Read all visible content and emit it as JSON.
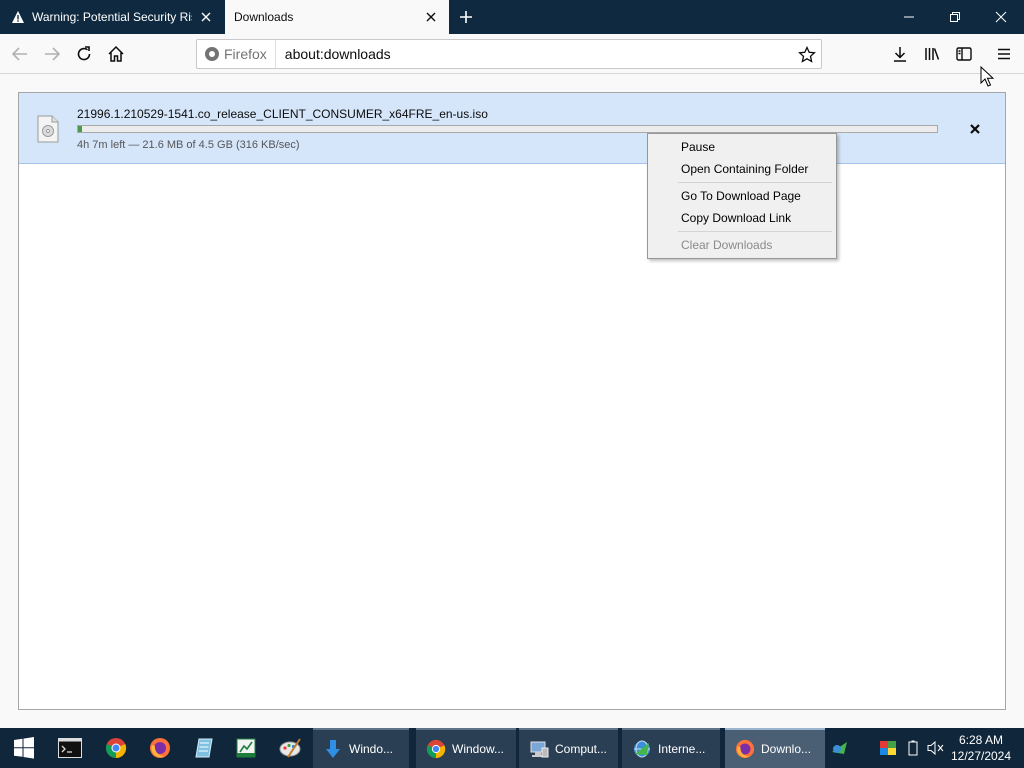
{
  "tabs": [
    {
      "title": "Warning: Potential Security Risk",
      "icon": "warning-icon",
      "active": false
    },
    {
      "title": "Downloads",
      "icon": "none",
      "active": true
    }
  ],
  "window_controls": {
    "minimize": "minimize-icon",
    "restore": "restore-icon",
    "close": "close-icon"
  },
  "nav": {
    "identity_label": "Firefox",
    "url": "about:downloads"
  },
  "download": {
    "file_name": "21996.1.210529-1541.co_release_CLIENT_CONSUMER_x64FRE_en-us.iso",
    "status": "4h 7m left — 21.6 MB of 4.5 GB (316 KB/sec)",
    "progress_fraction": 0.005
  },
  "context_menu": {
    "items": [
      {
        "label": "Pause",
        "enabled": true
      },
      {
        "label": "Open Containing Folder",
        "enabled": true
      },
      {
        "label": "Go To Download Page",
        "enabled": true
      },
      {
        "label": "Copy Download Link",
        "enabled": true
      },
      {
        "label": "Clear Downloads",
        "enabled": false
      }
    ]
  },
  "taskbar": {
    "pinned": [
      "start-icon",
      "terminal-icon",
      "chrome-icon",
      "firefox-icon",
      "notepad-icon",
      "spreadsheet-icon",
      "paint-icon"
    ],
    "tasks": [
      {
        "label": "Windo...",
        "icon": "download-arrow-icon",
        "active": false
      },
      {
        "label": "Window...",
        "icon": "chrome-icon",
        "active": false
      },
      {
        "label": "Comput...",
        "icon": "computer-icon",
        "active": false
      },
      {
        "label": "Interne...",
        "icon": "internet-download-icon",
        "active": false
      },
      {
        "label": "Downlo...",
        "icon": "firefox-icon",
        "active": true
      }
    ],
    "clock_time": "6:28 AM",
    "clock_date": "12/27/2024"
  },
  "colors": {
    "tabbar_bg": "#0f2a40",
    "download_item_bg": "#d6e6fa",
    "taskbar_bg": "#10263b"
  }
}
